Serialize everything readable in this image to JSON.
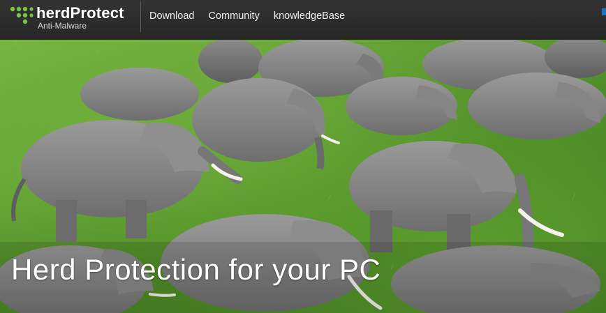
{
  "brand": {
    "name": "herdProtect",
    "tagline": "Anti-Malware",
    "accent_color": "#7bc142",
    "icon": "herd-dots-logo-icon"
  },
  "nav": {
    "items": [
      {
        "label": "Download"
      },
      {
        "label": "Community"
      },
      {
        "label": "knowledgeBase"
      }
    ]
  },
  "hero": {
    "headline": "Herd Protection for your PC",
    "image": "elephant-herd-photo"
  }
}
